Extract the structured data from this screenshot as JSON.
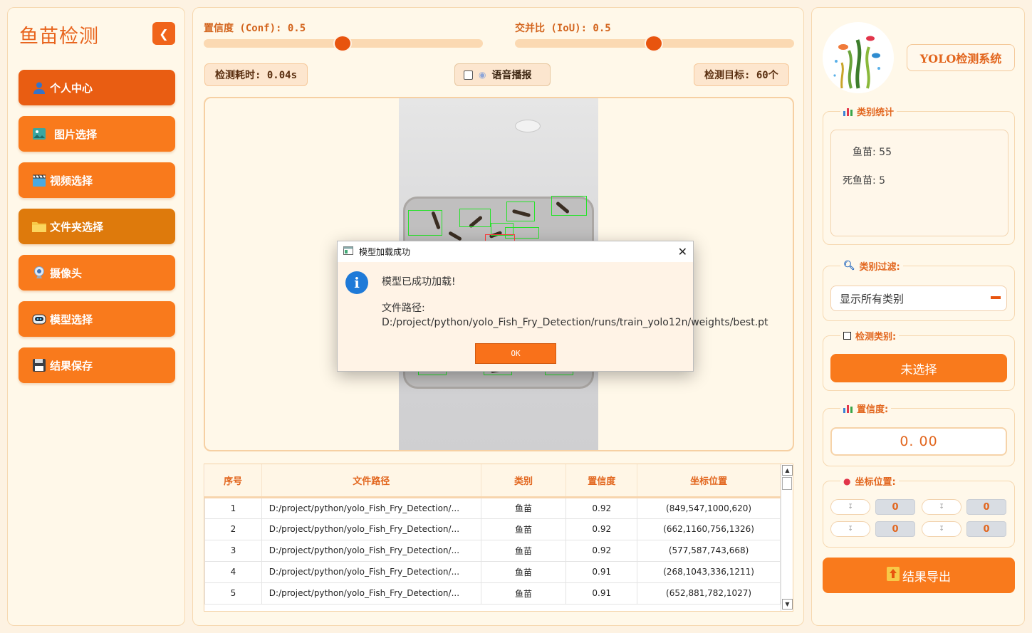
{
  "sidebar": {
    "title": "鱼苗检测",
    "items": [
      {
        "label": "个人中心",
        "icon": "user-icon"
      },
      {
        "label": "图片选择",
        "icon": "image-icon"
      },
      {
        "label": "视频选择",
        "icon": "clapperboard-icon"
      },
      {
        "label": "文件夹选择",
        "icon": "folder-icon"
      },
      {
        "label": "摄像头",
        "icon": "webcam-icon"
      },
      {
        "label": "模型选择",
        "icon": "robot-icon"
      },
      {
        "label": "结果保存",
        "icon": "floppy-icon"
      }
    ]
  },
  "controls": {
    "conf_label": "置信度 (Conf): 0.5",
    "conf_value": 0.5,
    "iou_label": "交并比 (IoU): 0.5",
    "iou_value": 0.5,
    "time_chip": "检测耗时: 0.04s",
    "voice_label": "语音播报",
    "voice_checked": false,
    "target_chip": "检测目标: 60个"
  },
  "table": {
    "headers": [
      "序号",
      "文件路径",
      "类别",
      "置信度",
      "坐标位置"
    ],
    "rows": [
      [
        "1",
        "D:/project/python/yolo_Fish_Fry_Detection/...",
        "鱼苗",
        "0.92",
        "(849,547,1000,620)"
      ],
      [
        "2",
        "D:/project/python/yolo_Fish_Fry_Detection/...",
        "鱼苗",
        "0.92",
        "(662,1160,756,1326)"
      ],
      [
        "3",
        "D:/project/python/yolo_Fish_Fry_Detection/...",
        "鱼苗",
        "0.92",
        "(577,587,743,668)"
      ],
      [
        "4",
        "D:/project/python/yolo_Fish_Fry_Detection/...",
        "鱼苗",
        "0.91",
        "(268,1043,336,1211)"
      ],
      [
        "5",
        "D:/project/python/yolo_Fish_Fry_Detection/...",
        "鱼苗",
        "0.91",
        "(652,881,782,1027)"
      ]
    ]
  },
  "right": {
    "system_title": "YOLO检测系统",
    "stats_title": "类别统计",
    "stats": [
      "鱼苗: 55",
      "死鱼苗: 5"
    ],
    "filter_title": "类别过滤:",
    "filter_value": "显示所有类别",
    "detect_class_title": "检测类别:",
    "detect_class_value": "未选择",
    "conf_title": "置信度:",
    "conf_value": "0. 00",
    "coord_title": "坐标位置:",
    "coords": [
      "0",
      "0",
      "0",
      "0"
    ],
    "export_label": "结果导出"
  },
  "dialog": {
    "title": "模型加载成功",
    "message": "模型已成功加载!",
    "path_line": "文件路径: D:/project/python/yolo_Fish_Fry_Detection/runs/train_yolo12n/weights/best.pt",
    "ok_label": "OK"
  },
  "colors": {
    "accent": "#f97a1c",
    "accent_dark": "#e8540e",
    "panel_bg": "#fff8e9",
    "info_blue": "#1f7ad8"
  }
}
